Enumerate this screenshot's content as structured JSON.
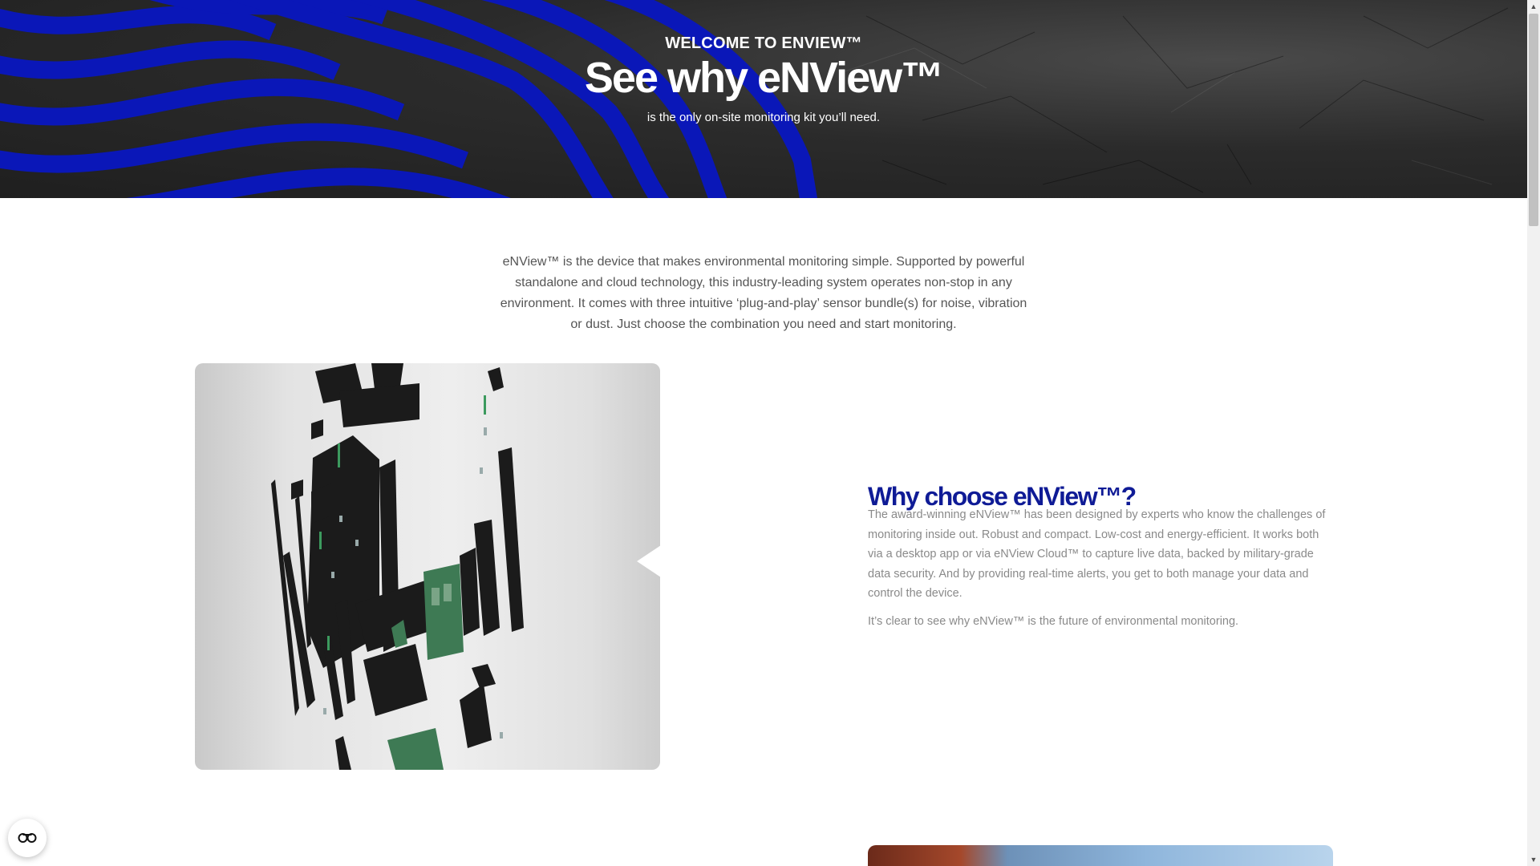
{
  "hero": {
    "kicker": "WELCOME TO ENVIEW™",
    "title": "See why eNView™",
    "subtitle": "is the only on-site monitoring kit you’ll need."
  },
  "intro": {
    "text": "eNView™ is the device that makes environmental monitoring simple. Supported by powerful standalone and cloud technology, this industry-leading system operates non-stop in any environment. It comes with three intuitive ‘plug-and-play’ sensor bundle(s) for noise, vibration or dust. Just choose the combination you need and start monitoring."
  },
  "why": {
    "title": "Why choose eNView™?",
    "paragraph1": "The award-winning eNView™ has been designed by experts who know the challenges of monitoring inside out. Robust and compact. Low-cost and energy-efficient. It works both via a desktop app or via eNView Cloud™ to capture live data, backed by military-grade data security. And by providing real-time alerts, you get to both manage your data and control the device.",
    "paragraph2": "It’s clear to see why eNView™ is the future of environmental monitoring."
  },
  "colors": {
    "brand_blue": "#0f1b96",
    "wave_blue": "#0a17b8",
    "body_text": "#8a8a8a"
  },
  "icons": {
    "accessibility": "accessibility-icon",
    "scroll_up": "scroll-up-arrow-icon",
    "scroll_down": "scroll-down-arrow-icon"
  }
}
